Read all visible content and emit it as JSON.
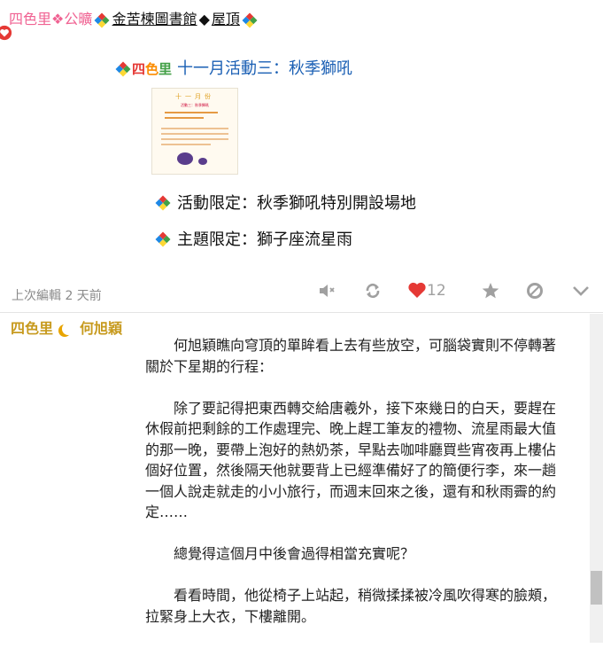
{
  "post1": {
    "author": {
      "name": "四色里",
      "separator": "❖",
      "role": "公曠",
      "location1": "金苦楝圖書館",
      "location_separator": "◆",
      "location2": "屋頂"
    },
    "title": {
      "logo_text": [
        "四",
        "色",
        "里"
      ],
      "text": "十一月活動三：秋季獅吼"
    },
    "poster": {
      "title": "十一月份",
      "subtitle": "活動三：秋季獅吼"
    },
    "bullets": [
      "活動限定：秋季獅吼特別開設場地",
      "主題限定：獅子座流星雨"
    ],
    "edit_note": "上次編輯 2 天前",
    "toolbar": {
      "like_count": "12"
    }
  },
  "post2": {
    "author": {
      "prefix": "四色里",
      "name": "何旭穎"
    },
    "paragraphs": [
      "何旭穎瞧向穹頂的單眸看上去有些放空，可腦袋實則不停轉著關於下星期的行程：",
      "除了要記得把東西轉交給唐羲外，接下來幾日的白天，要趕在休假前把剩餘的工作處理完、晚上趕工筆友的禮物、流星雨最大值的那一晚，要帶上泡好的熱奶茶，早點去咖啡廳買些宵夜再上樓佔個好位置，然後隔天他就要背上已經準備好了的簡便行李，來一趟一個人說走就走的小小旅行，而週末回來之後，還有和秋雨霽的約定……",
      "總覺得這個月中後會過得相當充實呢？",
      "看看時間，他從椅子上站起，稍微揉揉被冷風吹得寒的臉頰，拉緊身上大衣，下樓離開。"
    ]
  },
  "colors": {
    "accent_pink": "#f06292",
    "link_blue": "#1a5fb4",
    "author_gold": "#c79a1e",
    "like_red": "#e53935"
  }
}
